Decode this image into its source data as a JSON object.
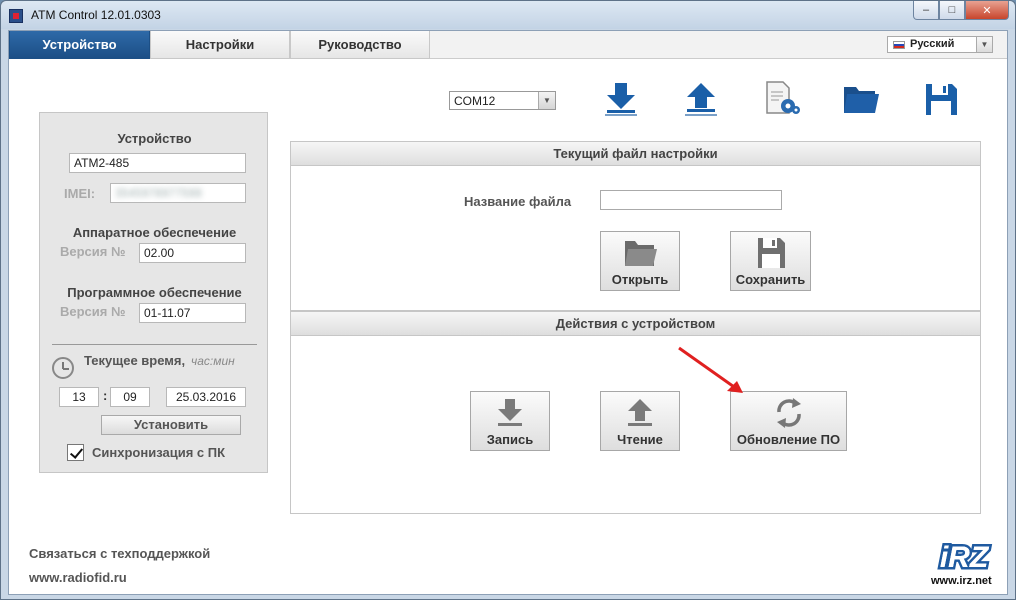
{
  "window": {
    "title": "ATM Control 12.01.0303",
    "min_symbol": "‒",
    "max_symbol": "□",
    "close_symbol": "✕"
  },
  "tabs": [
    {
      "label": "Устройство",
      "active": true
    },
    {
      "label": "Настройки",
      "active": false
    },
    {
      "label": "Руководство",
      "active": false
    }
  ],
  "language": {
    "selected": "Русский"
  },
  "device": {
    "section_title": "Устройство",
    "model": "ATM2-485",
    "imei_label": "IMEI:",
    "imei_value": "3545978977598",
    "hardware_title": "Аппаратное обеспечение",
    "hardware_version_label": "Версия №",
    "hardware_version": "02.00",
    "software_title": "Программное обеспечение",
    "software_version_label": "Версия №",
    "software_version": "01-11.07",
    "time_label": "Текущее время,",
    "time_hint": "час:мин",
    "hours": "13",
    "colon": ":",
    "minutes": "09",
    "date": "25.03.2016",
    "set_button": "Установить",
    "sync_label": "Синхронизация с ПК",
    "sync_checked": true
  },
  "toolbar": {
    "com_port": "COM12",
    "icons": [
      "download-icon",
      "upload-icon",
      "file-settings-icon",
      "folder-icon",
      "save-icon"
    ]
  },
  "config_panel": {
    "title": "Текущий файл настройки",
    "filename_label": "Название файла",
    "filename_value": "",
    "open_button": "Открыть",
    "save_button": "Сохранить"
  },
  "actions_panel": {
    "title": "Действия с устройством",
    "write_button": "Запись",
    "read_button": "Чтение",
    "update_button": "Обновление ПО"
  },
  "footer": {
    "support_link": "Связаться с техподдержкой",
    "site_link": "www.radiofid.ru",
    "logo_text": "iRZ",
    "logo_url": "www.irz.net"
  },
  "colors": {
    "active_tab": "#1f5590",
    "icon_blue": "#1a5fa8",
    "annotation_arrow": "#e02020"
  }
}
